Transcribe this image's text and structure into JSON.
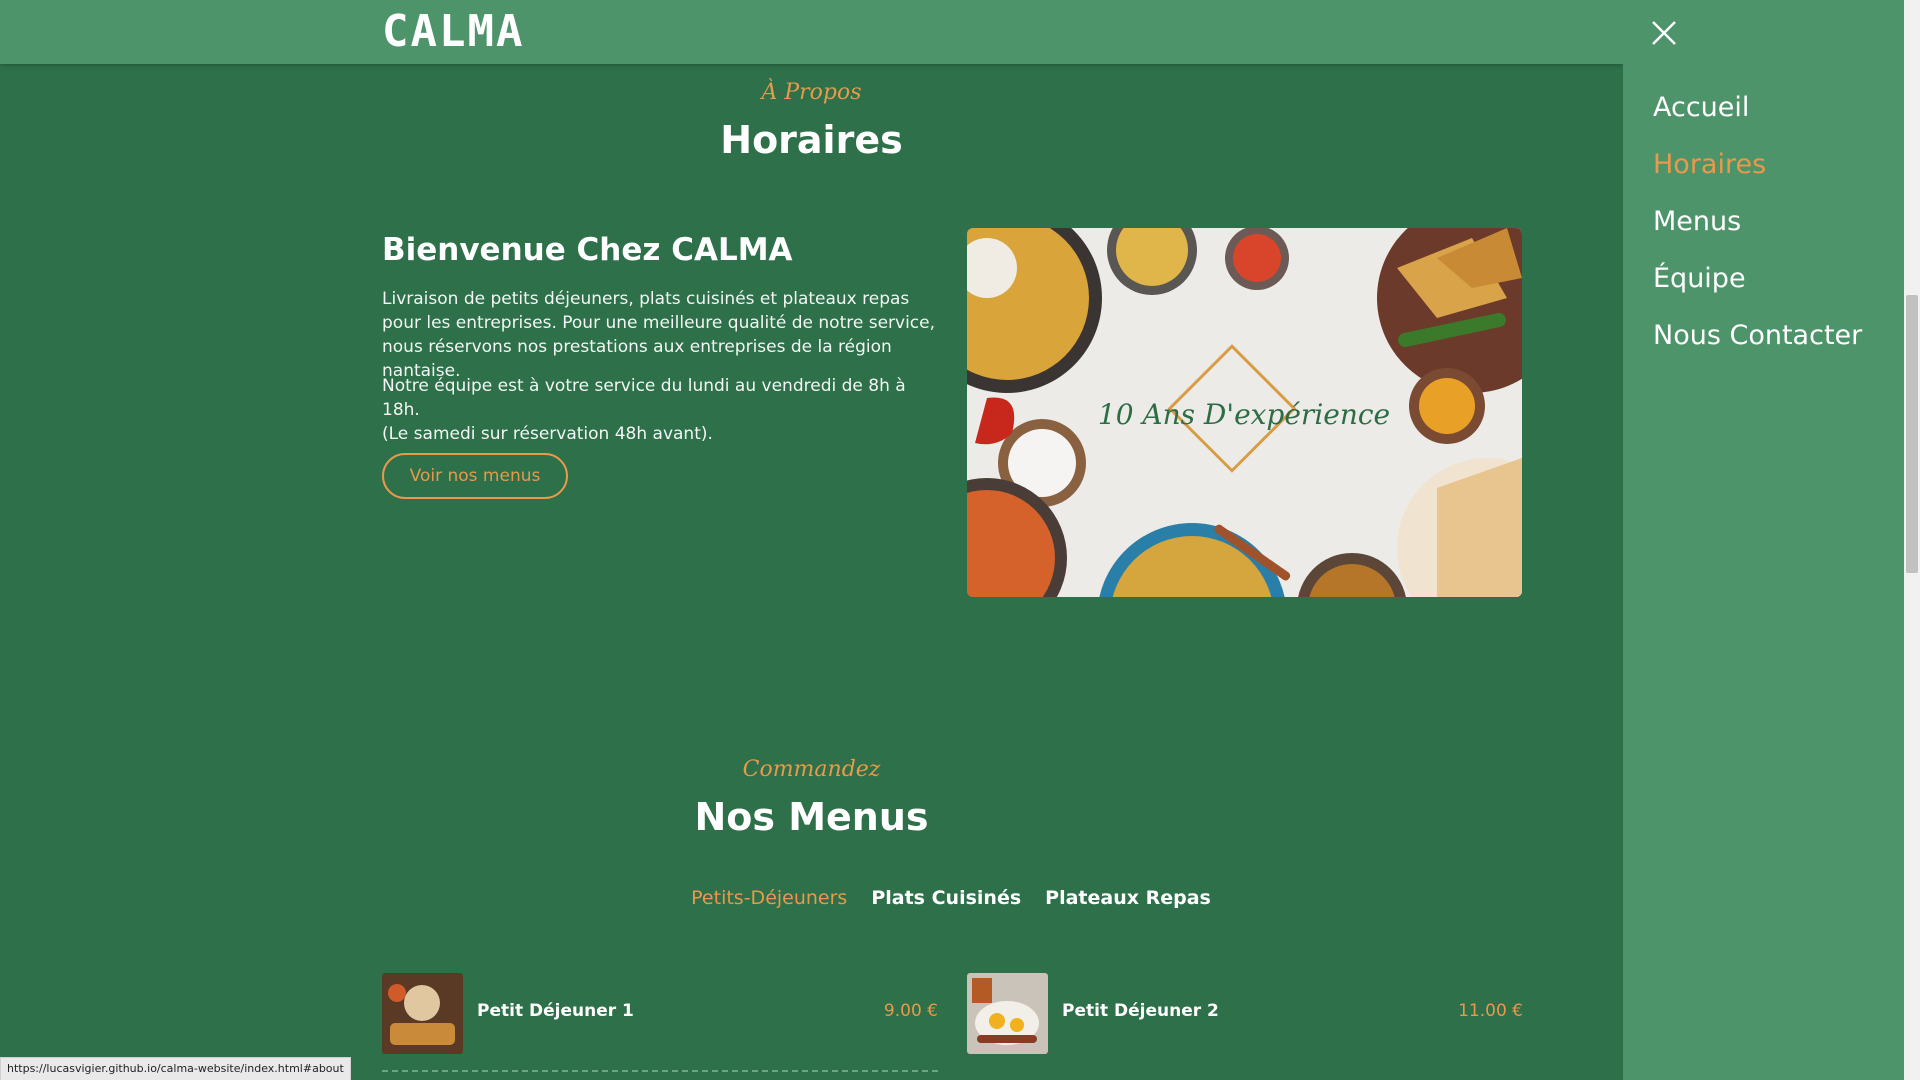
{
  "header": {
    "logo": "CALMA"
  },
  "about": {
    "sub": "À Propos",
    "title": "Horaires",
    "welcome": "Bienvenue Chez CALMA",
    "p1": "Livraison de petits déjeuners, plats cuisinés et plateaux repas pour les entreprises. Pour une meilleure qualité de notre service, nous réservons nos prestations aux entreprises de la région nantaise.",
    "p2a": "Notre équipe est à votre service du lundi au vendredi de 8h à 18h.",
    "p2b": "(Le samedi sur réservation 48h avant).",
    "button": "Voir nos menus",
    "image_caption": "10 Ans D'expérience"
  },
  "menus": {
    "sub": "Commandez",
    "title": "Nos Menus",
    "tabs": [
      "Petits-Déjeuners",
      "Plats Cuisinés",
      "Plateaux Repas"
    ],
    "items": [
      {
        "name": "Petit Déjeuner 1",
        "price": "9.00 €"
      },
      {
        "name": "Petit Déjeuner 2",
        "price": "11.00 €"
      }
    ]
  },
  "drawer": {
    "items": [
      "Accueil",
      "Horaires",
      "Menus",
      "Équipe",
      "Nous Contacter"
    ]
  },
  "status": {
    "url": "https://lucasvigier.github.io/calma-website/index.html#about"
  },
  "colors": {
    "bg": "#2d7049",
    "bar": "#4e946b",
    "accent": "#e8994b"
  }
}
